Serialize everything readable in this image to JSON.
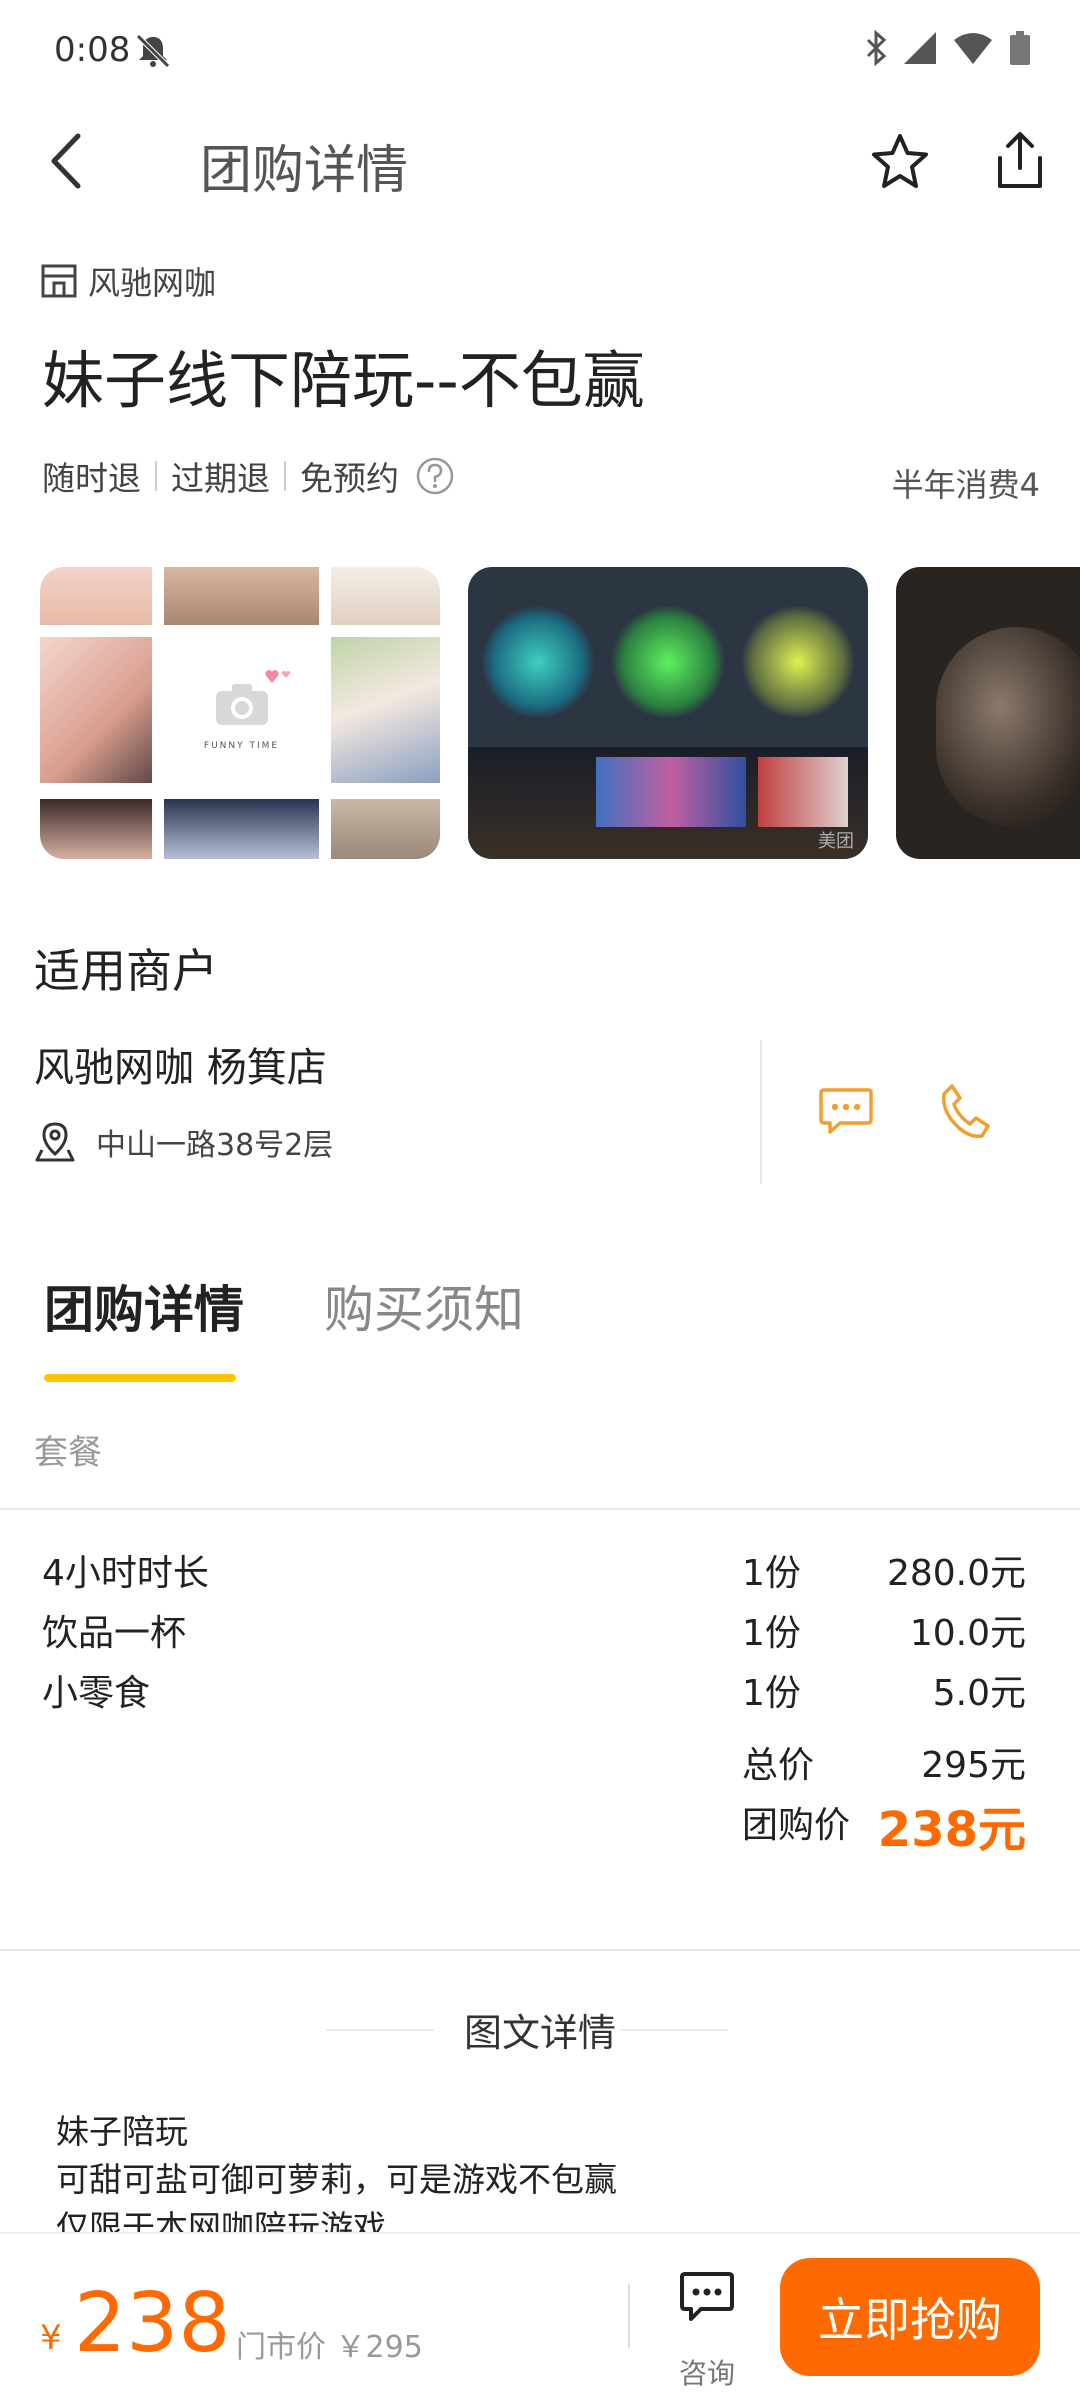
{
  "status_bar": {
    "time": "0:08"
  },
  "nav": {
    "title": "团购详情"
  },
  "shop": {
    "tag": "风驰网咖"
  },
  "deal": {
    "title": "妹子线下陪玩--不包赢",
    "policies": [
      "随时退",
      "过期退",
      "免预约"
    ],
    "sales": "半年消费4"
  },
  "gallery": {
    "collage_caption": "FUNNY TIME",
    "watermark": "美团"
  },
  "merchant": {
    "section_title": "适用商户",
    "name": "风驰网咖 杨箕店",
    "address": "中山一路38号2层"
  },
  "tabs": {
    "active": "团购详情",
    "inactive": "购买须知"
  },
  "package": {
    "label": "套餐",
    "items": [
      {
        "name": "4小时时长",
        "qty": "1份",
        "price": "280.0元"
      },
      {
        "name": "饮品一杯",
        "qty": "1份",
        "price": "10.0元"
      },
      {
        "name": "小零食",
        "qty": "1份",
        "price": "5.0元"
      }
    ],
    "total_label": "总价",
    "total_value": "295元",
    "deal_label": "团购价",
    "deal_value": "238元"
  },
  "details": {
    "heading": "图文详情",
    "lines": [
      "妹子陪玩",
      "可甜可盐可御可萝莉，可是游戏不包赢",
      "仅限于本网咖陪玩游戏"
    ]
  },
  "bottom": {
    "currency": "¥",
    "price": "238",
    "market_price": "门市价 ￥295",
    "consult_label": "咨询",
    "buy_label": "立即抢购"
  },
  "colors": {
    "accent": "#ff6a00",
    "tab_underline": "#ffc300",
    "icon_orange": "#f0a030"
  }
}
